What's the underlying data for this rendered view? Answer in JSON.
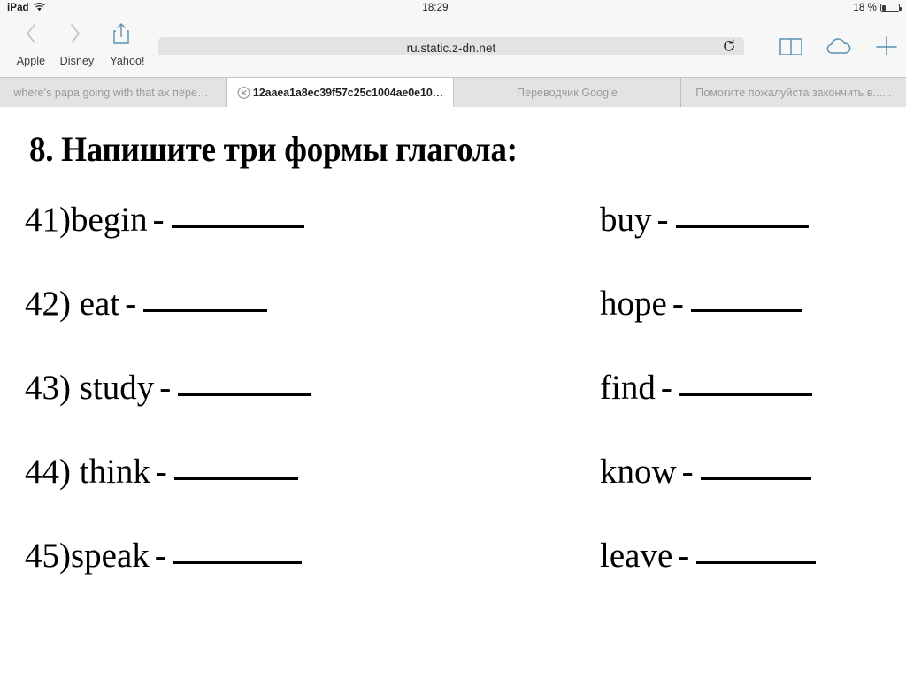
{
  "status_bar": {
    "device": "iPad",
    "wifi_icon": "wifi-icon",
    "time": "18:29",
    "battery_percent": "18 %"
  },
  "toolbar": {
    "back_icon": "chevron-left-icon",
    "forward_icon": "chevron-right-icon",
    "share_icon": "share-icon",
    "url": "ru.static.z-dn.net",
    "url_placeholder": "Search or enter website name",
    "reload_icon": "reload-icon",
    "bookmarks_icon": "book-icon",
    "icloud_tabs_icon": "cloud-icon",
    "new_tab_icon": "plus-icon"
  },
  "bookmarks": [
    {
      "label": "Apple"
    },
    {
      "label": "Disney"
    },
    {
      "label": "Yahoo!"
    }
  ],
  "tabs": [
    {
      "title": "where's papa going with that ax перев…",
      "active": false,
      "close_icon": ""
    },
    {
      "title": "12aaea1a8ec39f57c25c1004ae0e10…",
      "active": true,
      "close_icon": "close-icon"
    },
    {
      "title": "Переводчик Google",
      "active": false,
      "close_icon": ""
    },
    {
      "title": "Помогите пожалуйста закончить в......",
      "active": false,
      "close_icon": ""
    }
  ],
  "worksheet": {
    "title": "8. Напишите три формы глагола:",
    "dash": "-",
    "left_column": [
      {
        "label": "41)begin"
      },
      {
        "label": "42) eat"
      },
      {
        "label": "43) study"
      },
      {
        "label": "44) think"
      },
      {
        "label": "45)speak"
      }
    ],
    "right_column": [
      {
        "label": "buy"
      },
      {
        "label": "hope"
      },
      {
        "label": "find"
      },
      {
        "label": "know"
      },
      {
        "label": "leave"
      }
    ]
  },
  "colors": {
    "chrome_bg": "#f7f7f7",
    "tab_inactive_bg": "#e3e3e3",
    "tab_active_bg": "#ffffff",
    "url_field_bg": "#e3e3e5",
    "accent_blue": "#4a7fa5",
    "page_bg": "#ffffff",
    "text_black": "#000000"
  }
}
